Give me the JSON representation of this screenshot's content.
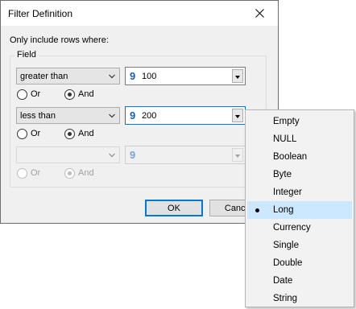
{
  "dialog": {
    "title": "Filter Definition",
    "caption": "Only include rows where:",
    "group_label": "Field",
    "ok_label": "OK",
    "cancel_label": "Cancel",
    "close_icon": "close-icon"
  },
  "rows": [
    {
      "operator": "greater than",
      "type_glyph": "9",
      "value": "100",
      "or_label": "Or",
      "and_label": "And",
      "logic": "And",
      "enabled": true
    },
    {
      "operator": "less than",
      "type_glyph": "9",
      "value": "200",
      "or_label": "Or",
      "and_label": "And",
      "logic": "And",
      "enabled": true
    },
    {
      "operator": "",
      "type_glyph": "9",
      "value": "",
      "or_label": "Or",
      "and_label": "And",
      "logic": "And",
      "enabled": false
    }
  ],
  "type_menu": {
    "items": [
      "Empty",
      "NULL",
      "Boolean",
      "Byte",
      "Integer",
      "Long",
      "Currency",
      "Single",
      "Double",
      "Date",
      "String"
    ],
    "selected": "Long",
    "highlight_color": "#cce8ff"
  },
  "colors": {
    "accent": "#0078d7",
    "type_glyph": "#1e5fb4",
    "dialog_bg": "#f0f0f0"
  }
}
